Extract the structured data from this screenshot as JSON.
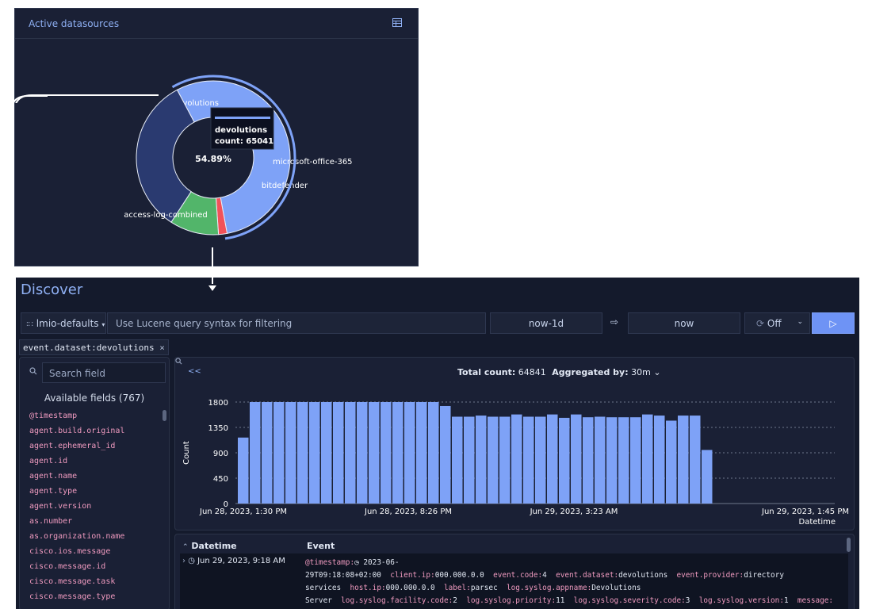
{
  "datasources_card": {
    "title": "Active datasources",
    "center_percent": "54.89%",
    "tooltip": {
      "name": "devolutions",
      "count_text": "count: 65041"
    },
    "chart_data": {
      "type": "pie",
      "title": "Active datasources",
      "slices": [
        {
          "label": "devolutions",
          "percent": 54.89,
          "color": "#7ea2f7"
        },
        {
          "label": "microsoft-office-365",
          "percent": 1.8,
          "color": "#f1525a"
        },
        {
          "label": "bitdefender",
          "percent": 10.3,
          "color": "#52b56a"
        },
        {
          "label": "access-log-combined",
          "percent": 33.01,
          "color": "#2a3a70"
        }
      ]
    }
  },
  "discover": {
    "title": "Discover",
    "tenant": "lmio-defaults",
    "query_placeholder": "Use Lucene query syntax for filtering",
    "date_from": "now-1d",
    "date_arrow": "⇨",
    "date_to": "now",
    "refresh": "Off",
    "filter_key": "event.dataset:",
    "filter_value": "devolutions",
    "filter_close": "×",
    "sidebar": {
      "search_placeholder": "Search field",
      "available_label": "Available fields (767)",
      "fields": [
        "@timestamp",
        "agent.build.original",
        "agent.ephemeral_id",
        "agent.id",
        "agent.name",
        "agent.type",
        "agent.version",
        "as.number",
        "as.organization.name",
        "cisco.ios.message",
        "cisco.message.id",
        "cisco.message.task",
        "cisco.message.type"
      ]
    },
    "histogram": {
      "collapse": "<<",
      "total_label": "Total count:",
      "total_value": "64841",
      "agg_label": "Aggregated by:",
      "agg_value": "30m"
    },
    "events": {
      "col_datetime": "Datetime",
      "col_event": "Event",
      "row_datetime": "Jun 29, 2023, 9:18 AM"
    }
  },
  "chart_data": {
    "type": "bar",
    "ylabel": "Count",
    "xlabel": "Datetime",
    "ylim": [
      0,
      1800
    ],
    "yticks": [
      0,
      450,
      900,
      1350,
      1800
    ],
    "xticks": [
      "Jun 28, 2023, 1:30 PM",
      "Jun 28, 2023, 8:26 PM",
      "Jun 29, 2023, 3:23 AM",
      "Jun 29, 2023, 1:45 PM"
    ],
    "grid": true,
    "values": [
      1170,
      1800,
      1800,
      1800,
      1800,
      1800,
      1800,
      1800,
      1800,
      1800,
      1800,
      1800,
      1800,
      1800,
      1800,
      1800,
      1800,
      1730,
      1540,
      1540,
      1560,
      1540,
      1540,
      1580,
      1540,
      1540,
      1580,
      1520,
      1580,
      1530,
      1540,
      1530,
      1530,
      1530,
      1580,
      1560,
      1470,
      1560,
      1560,
      950
    ]
  }
}
